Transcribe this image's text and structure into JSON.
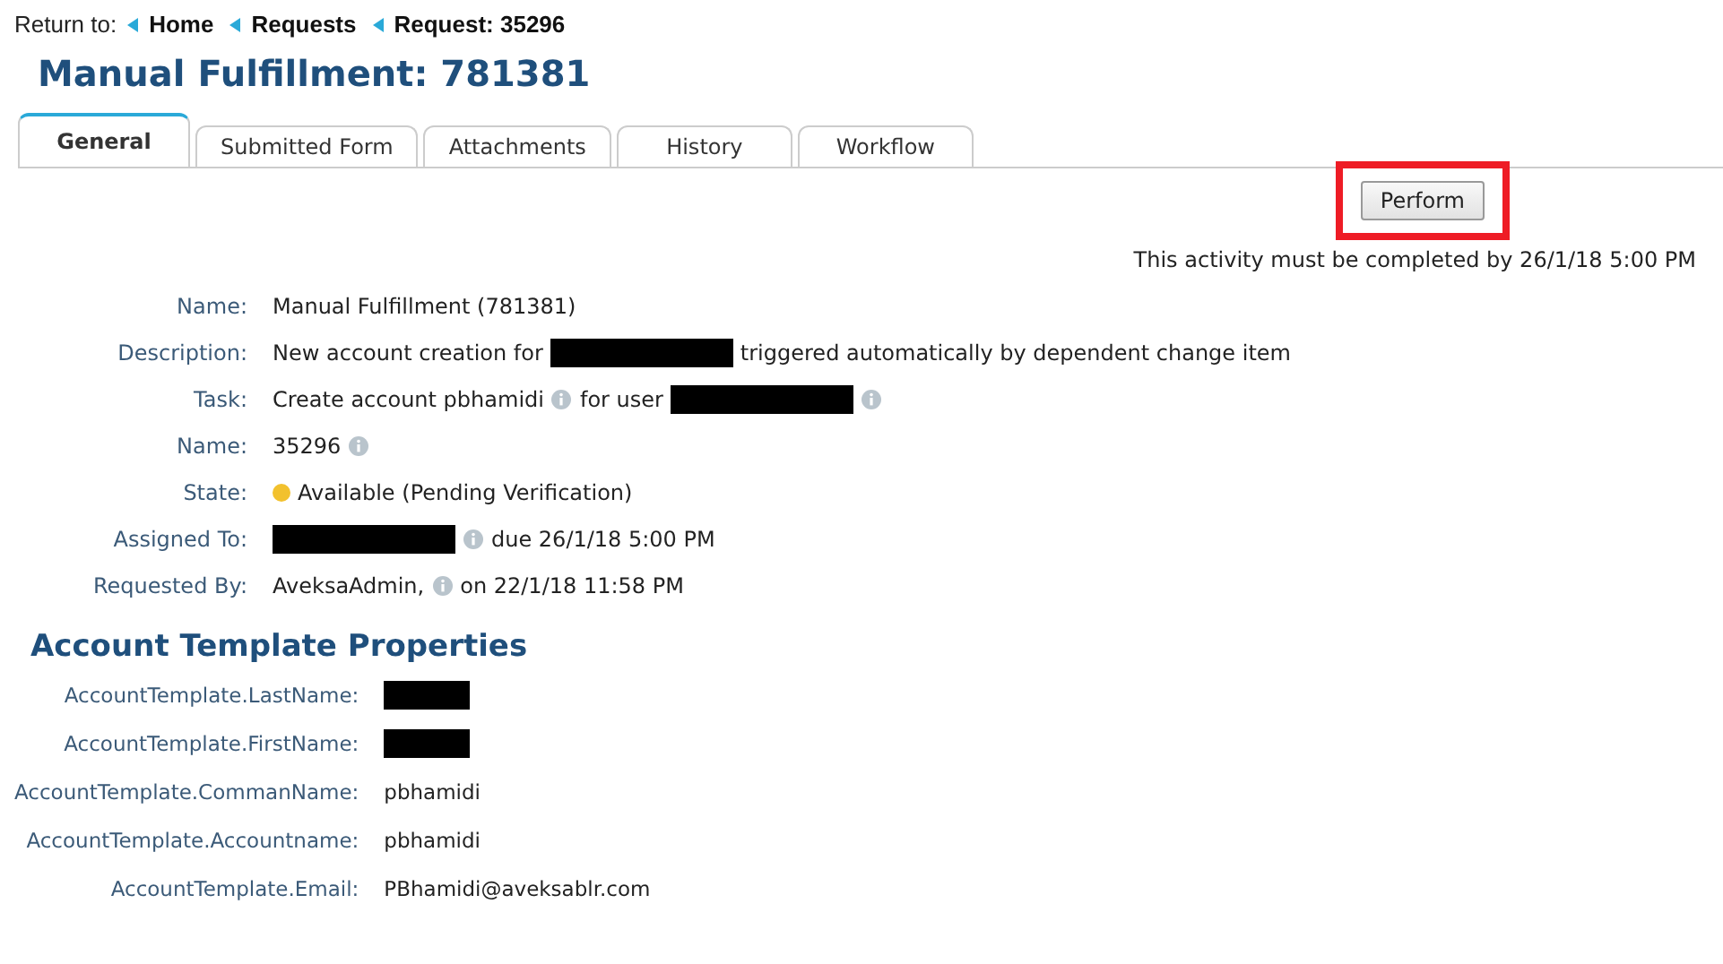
{
  "breadcrumb": {
    "label": "Return to:",
    "links": [
      "Home",
      "Requests",
      "Request: 35296"
    ]
  },
  "title": "Manual Fulfillment: 781381",
  "tabs": [
    {
      "label": "General",
      "selected": true
    },
    {
      "label": "Submitted Form",
      "selected": false
    },
    {
      "label": "Attachments",
      "selected": false
    },
    {
      "label": "History",
      "selected": false
    },
    {
      "label": "Workflow",
      "selected": false
    }
  ],
  "action": {
    "button": "Perform",
    "highlighted": true,
    "deadline": "This activity must be completed by 26/1/18 5:00 PM"
  },
  "details": [
    {
      "label": "Name:",
      "parts": [
        {
          "kind": "text",
          "text": "Manual Fulfillment (781381)"
        }
      ]
    },
    {
      "label": "Description:",
      "parts": [
        {
          "kind": "text",
          "text": "New account creation for"
        },
        {
          "kind": "redacted"
        },
        {
          "kind": "text",
          "text": "triggered automatically by dependent change item"
        }
      ]
    },
    {
      "label": "Task:",
      "parts": [
        {
          "kind": "text",
          "text": "Create account pbhamidi"
        },
        {
          "kind": "info"
        },
        {
          "kind": "text",
          "text": "for user"
        },
        {
          "kind": "redacted"
        },
        {
          "kind": "info"
        }
      ]
    },
    {
      "label": "Name:",
      "parts": [
        {
          "kind": "text",
          "text": "35296"
        },
        {
          "kind": "info"
        }
      ]
    },
    {
      "label": "State:",
      "parts": [
        {
          "kind": "status",
          "color": "#f2c12e"
        },
        {
          "kind": "text",
          "text": "Available (Pending Verification)"
        }
      ]
    },
    {
      "label": "Assigned To:",
      "parts": [
        {
          "kind": "redacted"
        },
        {
          "kind": "info"
        },
        {
          "kind": "text",
          "text": "due 26/1/18 5:00 PM"
        }
      ]
    },
    {
      "label": "Requested By:",
      "parts": [
        {
          "kind": "text",
          "text": "AveksaAdmin,"
        },
        {
          "kind": "info"
        },
        {
          "kind": "text",
          "text": "on 22/1/18 11:58 PM"
        }
      ]
    }
  ],
  "properties": {
    "heading": "Account Template Properties",
    "rows": [
      {
        "label": "AccountTemplate.LastName:",
        "parts": [
          {
            "kind": "redacted"
          }
        ]
      },
      {
        "label": "AccountTemplate.FirstName:",
        "parts": [
          {
            "kind": "redacted"
          }
        ]
      },
      {
        "label": "AccountTemplate.CommanName:",
        "parts": [
          {
            "kind": "text",
            "text": "pbhamidi"
          }
        ]
      },
      {
        "label": "AccountTemplate.Accountname:",
        "parts": [
          {
            "kind": "text",
            "text": "pbhamidi"
          }
        ]
      },
      {
        "label": "AccountTemplate.Email:",
        "parts": [
          {
            "kind": "text",
            "text": "PBhamidi@aveksablr.com"
          }
        ]
      }
    ]
  }
}
